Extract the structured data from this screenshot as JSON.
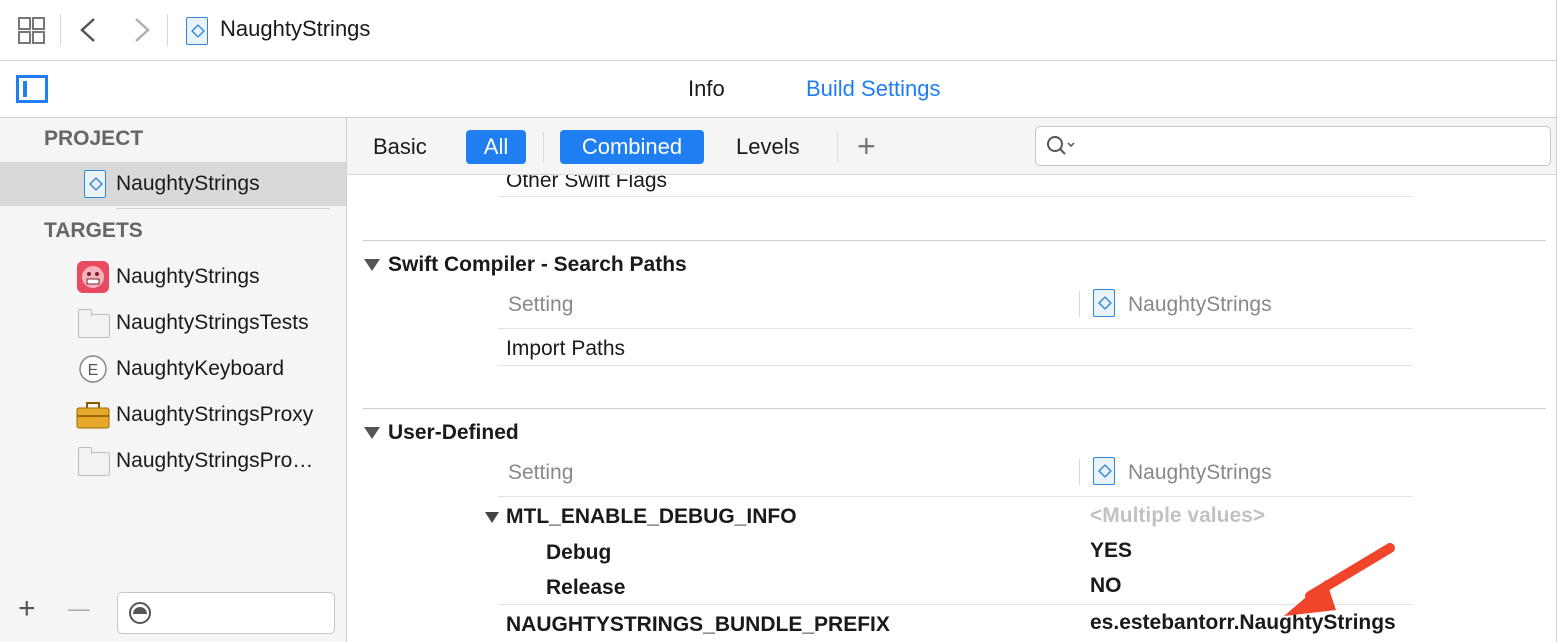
{
  "jumpbar": {
    "project_name": "NaughtyStrings"
  },
  "tabs": {
    "info": "Info",
    "build_settings": "Build Settings"
  },
  "sidebar": {
    "project_header": "PROJECT",
    "project_item": "NaughtyStrings",
    "targets_header": "TARGETS",
    "targets": [
      {
        "label": "NaughtyStrings",
        "icon": "app-icon"
      },
      {
        "label": "NaughtyStringsTests",
        "icon": "test-bundle-icon"
      },
      {
        "label": "NaughtyKeyboard",
        "icon": "extension-icon"
      },
      {
        "label": "NaughtyStringsProxy",
        "icon": "toolbox-icon"
      },
      {
        "label": "NaughtyStringsPro…",
        "icon": "test-bundle-icon"
      }
    ],
    "add_label": "+",
    "remove_label": "—"
  },
  "filterbar": {
    "basic": "Basic",
    "all": "All",
    "combined": "Combined",
    "levels": "Levels",
    "add": "+"
  },
  "content": {
    "other_swift_flags": "Other Swift Flags",
    "section1": {
      "title": "Swift Compiler - Search Paths",
      "setting_header": "Setting",
      "target_header": "NaughtyStrings",
      "rows": [
        "Import Paths"
      ]
    },
    "section2": {
      "title": "User-Defined",
      "setting_header": "Setting",
      "target_header": "NaughtyStrings",
      "mtl_name": "MTL_ENABLE_DEBUG_INFO",
      "mtl_value": "<Multiple values>",
      "debug_label": "Debug",
      "debug_value": "YES",
      "release_label": "Release",
      "release_value": "NO",
      "prefix_name": "NAUGHTYSTRINGS_BUNDLE_PREFIX",
      "prefix_value": "es.estebantorr.NaughtyStrings"
    }
  },
  "colors": {
    "accent": "#1f7ef2",
    "arrow": "#f0442b"
  }
}
